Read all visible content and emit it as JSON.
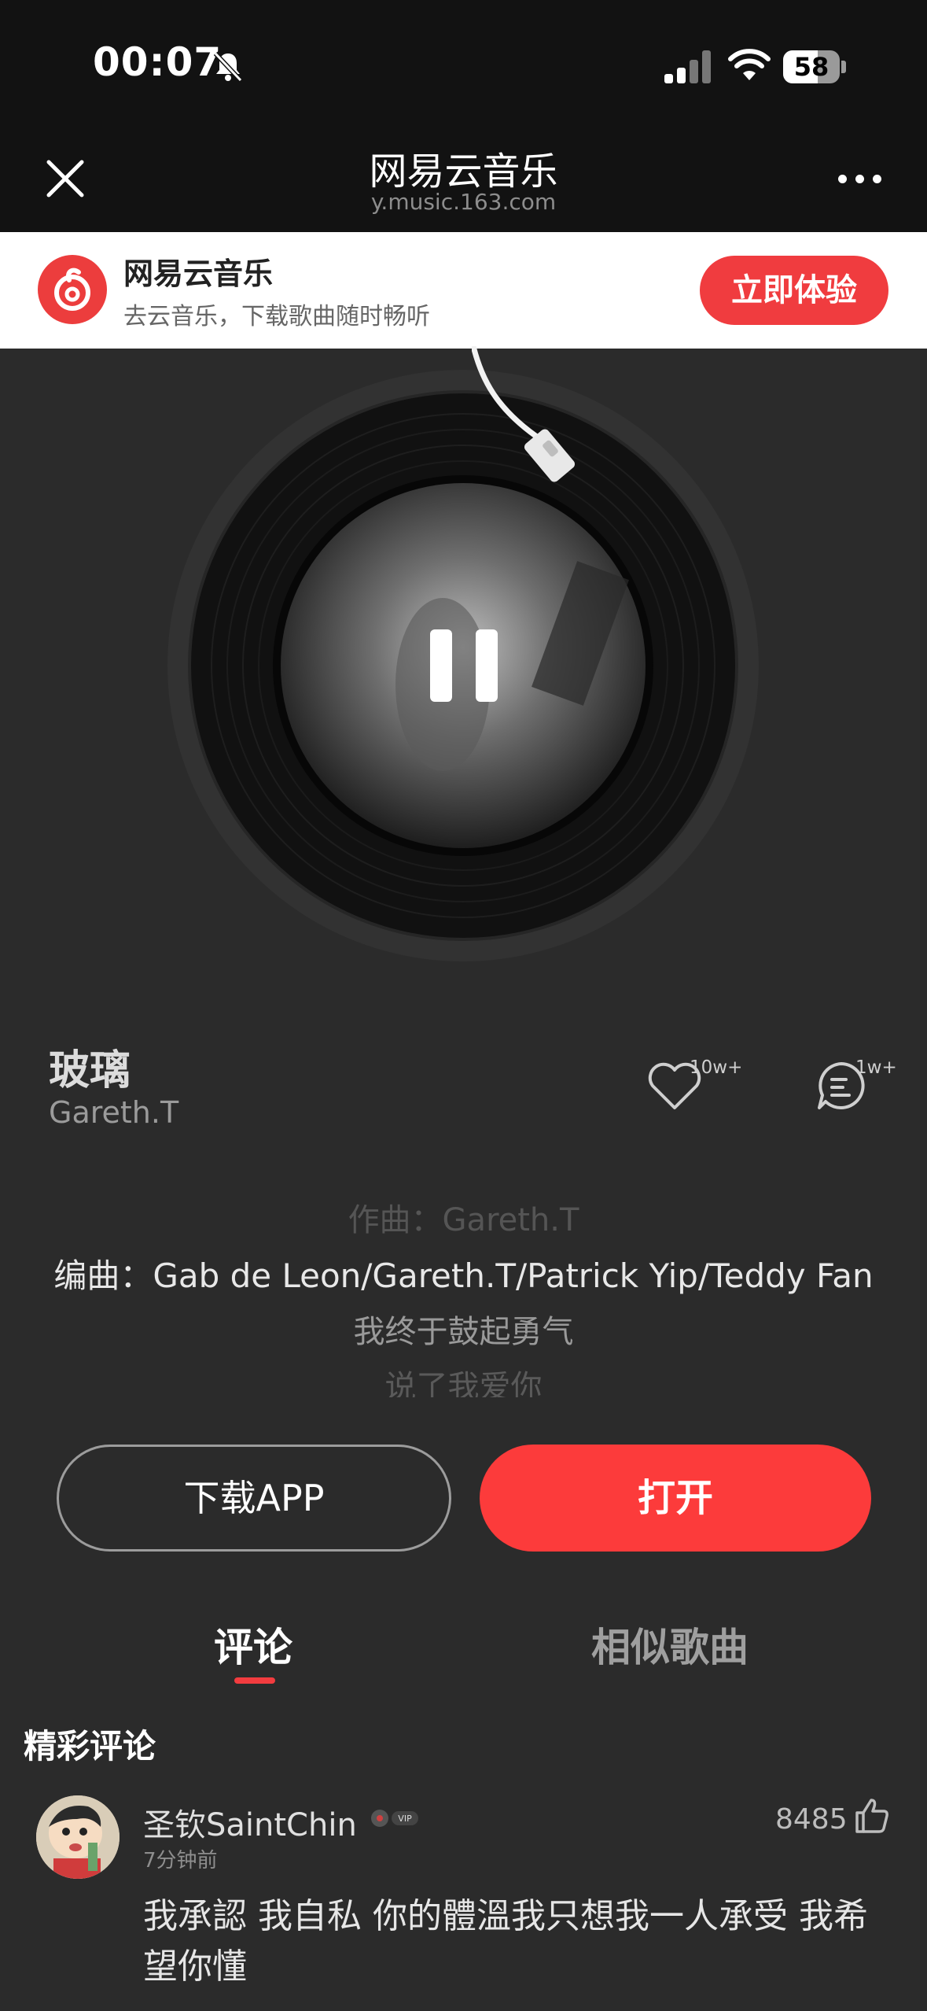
{
  "status_bar": {
    "time": "00:07",
    "battery": "58"
  },
  "nav": {
    "title": "网易云音乐",
    "url": "y.music.163.com"
  },
  "banner": {
    "title": "网易云音乐",
    "subtitle": "去云音乐，下载歌曲随时畅听",
    "cta": "立即体验"
  },
  "song": {
    "title": "玻璃",
    "artist": "Gareth.T",
    "likes": "10w+",
    "comments": "1w+"
  },
  "lyrics": [
    "作曲：Gareth.T",
    "编曲：Gab de Leon/Gareth.T/Patrick Yip/Teddy Fan",
    "我终于鼓起勇气",
    "说了我爱你"
  ],
  "actions": {
    "download": "下载APP",
    "open": "打开"
  },
  "tabs": [
    {
      "label": "评论",
      "active": true
    },
    {
      "label": "相似歌曲",
      "active": false
    }
  ],
  "comments_section": {
    "title": "精彩评论",
    "items": [
      {
        "user": "圣钦SaintChin",
        "badge": "VIP",
        "time": "7分钟前",
        "likes": "8485",
        "text": "我承認 我自私 你的體溫我只想我一人承受 我希望你懂"
      }
    ]
  },
  "colors": {
    "accent": "#fc3b3b",
    "background": "#2b2b2b",
    "header": "#121212"
  }
}
